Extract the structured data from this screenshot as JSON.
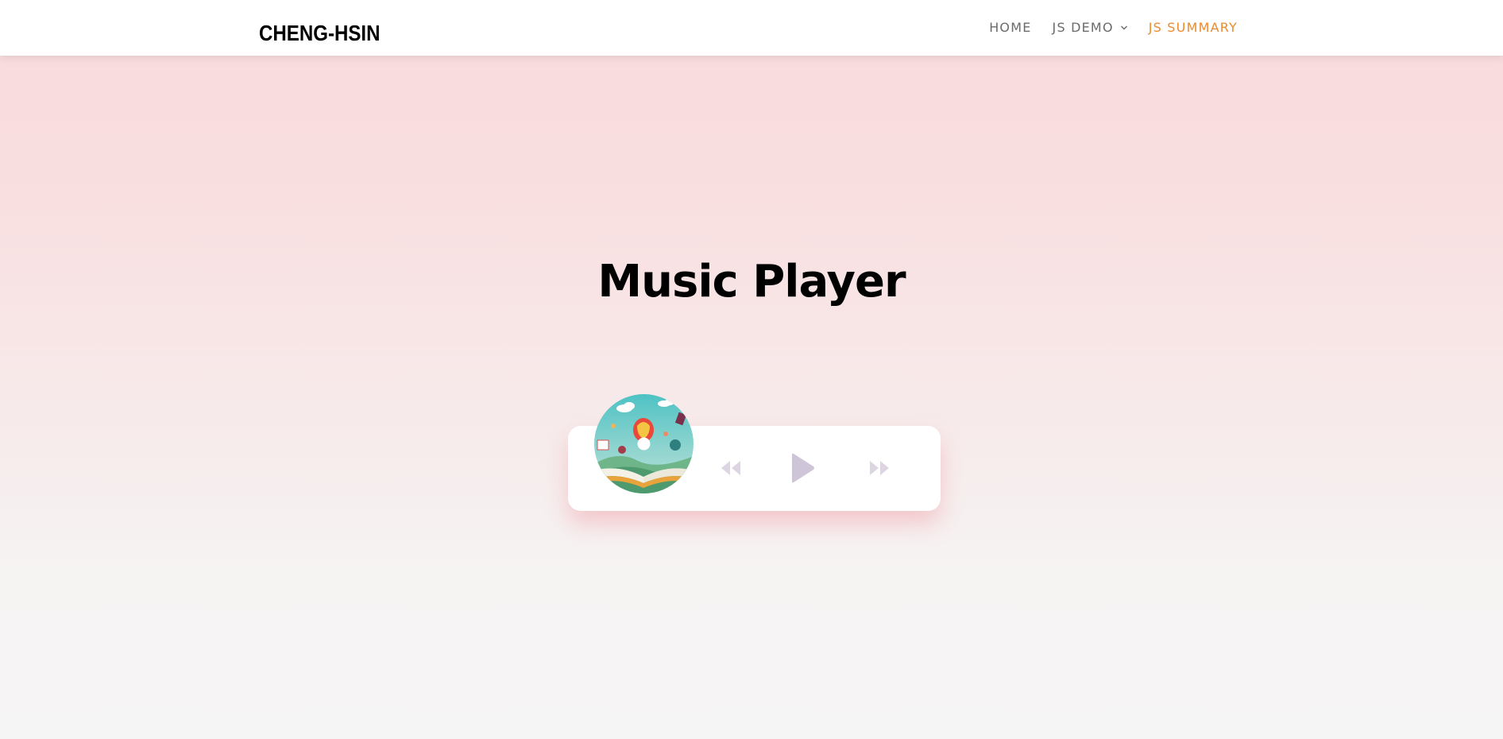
{
  "header": {
    "brand": "CHENG-HSIN",
    "nav": {
      "home": "HOME",
      "js_demo": "JS DEMO",
      "js_summary": "JS SUMMARY"
    }
  },
  "main": {
    "title": "Music Player"
  },
  "player": {
    "cover_icon": "album-cover-image",
    "prev_icon": "rewind-icon",
    "play_icon": "play-icon",
    "next_icon": "fast-forward-icon"
  },
  "colors": {
    "active_nav": "#ee8a2c",
    "nav_text": "#6b6b6b",
    "control_light": "#ddd6e2",
    "play_color": "#cfc5d8"
  }
}
